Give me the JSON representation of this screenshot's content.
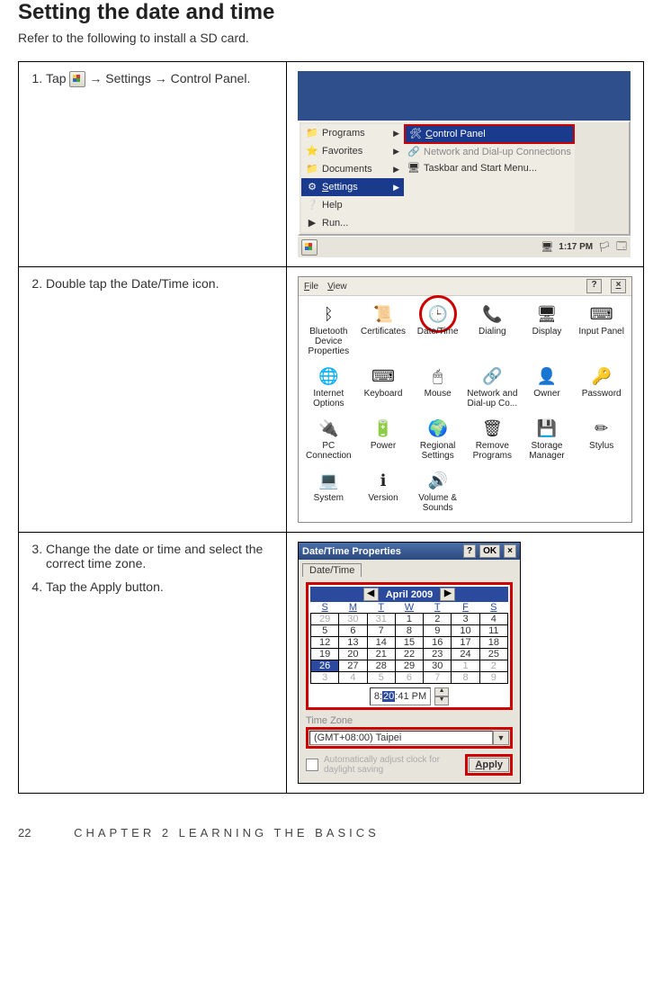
{
  "heading": "Setting the date and time",
  "intro": "Refer to the following to install a SD card.",
  "steps": {
    "s1_pre": "Tap ",
    "s1_post": " → Settings → Control Panel.",
    "s2": "Double tap the Date/Time icon.",
    "s3": "Change the date or time and select the correct time zone.",
    "s4": "Tap the Apply button."
  },
  "shot1": {
    "menu": [
      "Programs",
      "Favorites",
      "Documents",
      "Settings",
      "Help",
      "Run..."
    ],
    "submenu": [
      "Control Panel",
      "Network and Dial-up Connections",
      "Taskbar and Start Menu..."
    ],
    "clock": "1:17 PM"
  },
  "shot2": {
    "menus": [
      "File",
      "View"
    ],
    "items": [
      "Bluetooth Device Properties",
      "Certificates",
      "Date/Time",
      "Dialing",
      "Display",
      "Input Panel",
      "Internet Options",
      "Keyboard",
      "Mouse",
      "Network and Dial-up Co...",
      "Owner",
      "Password",
      "PC Connection",
      "Power",
      "Regional Settings",
      "Remove Programs",
      "Storage Manager",
      "Stylus",
      "System",
      "Version",
      "Volume & Sounds"
    ],
    "highlight_index": 2
  },
  "shot3": {
    "title": "Date/Time Properties",
    "ok": "OK",
    "tab": "Date/Time",
    "month": "April 2009",
    "dow": [
      "S",
      "M",
      "T",
      "W",
      "T",
      "F",
      "S"
    ],
    "weeks": [
      [
        {
          "d": "29",
          "g": true
        },
        {
          "d": "30",
          "g": true
        },
        {
          "d": "31",
          "g": true
        },
        {
          "d": "1"
        },
        {
          "d": "2"
        },
        {
          "d": "3"
        },
        {
          "d": "4"
        }
      ],
      [
        {
          "d": "5"
        },
        {
          "d": "6"
        },
        {
          "d": "7"
        },
        {
          "d": "8"
        },
        {
          "d": "9"
        },
        {
          "d": "10"
        },
        {
          "d": "11"
        }
      ],
      [
        {
          "d": "12"
        },
        {
          "d": "13"
        },
        {
          "d": "14"
        },
        {
          "d": "15"
        },
        {
          "d": "16"
        },
        {
          "d": "17"
        },
        {
          "d": "18"
        }
      ],
      [
        {
          "d": "19"
        },
        {
          "d": "20"
        },
        {
          "d": "21"
        },
        {
          "d": "22"
        },
        {
          "d": "23"
        },
        {
          "d": "24"
        },
        {
          "d": "25"
        }
      ],
      [
        {
          "d": "26",
          "today": true
        },
        {
          "d": "27"
        },
        {
          "d": "28"
        },
        {
          "d": "29"
        },
        {
          "d": "30"
        },
        {
          "d": "1",
          "g": true
        },
        {
          "d": "2",
          "g": true
        }
      ],
      [
        {
          "d": "3",
          "g": true
        },
        {
          "d": "4",
          "g": true
        },
        {
          "d": "5",
          "g": true
        },
        {
          "d": "6",
          "g": true
        },
        {
          "d": "7",
          "g": true
        },
        {
          "d": "8",
          "g": true
        },
        {
          "d": "9",
          "g": true
        }
      ]
    ],
    "time_pre": "8:",
    "time_sel": "20",
    "time_post": ":41 PM",
    "tz_label": "Time Zone",
    "tz_value": "(GMT+08:00) Taipei",
    "auto": "Automatically adjust clock for daylight saving",
    "apply": "Apply"
  },
  "footer": {
    "page": "22",
    "text": "CHAPTER 2 LEARNING THE BASICS"
  }
}
